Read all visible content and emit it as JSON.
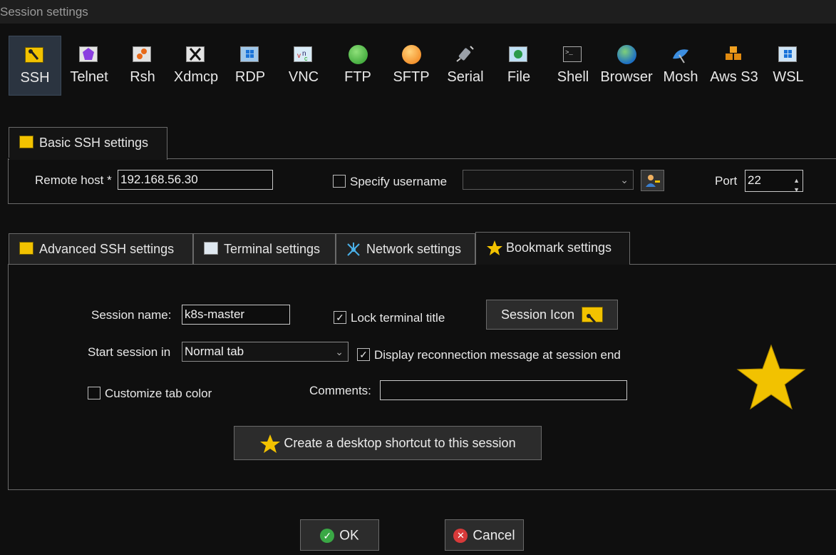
{
  "window": {
    "title": "Session settings"
  },
  "protocols": [
    {
      "label": "SSH",
      "icon": "key-icon",
      "active": true
    },
    {
      "label": "Telnet",
      "icon": "purple-gem-icon"
    },
    {
      "label": "Rsh",
      "icon": "gears-icon"
    },
    {
      "label": "Xdmcp",
      "icon": "x-logo-icon"
    },
    {
      "label": "RDP",
      "icon": "windows-monitor-icon"
    },
    {
      "label": "VNC",
      "icon": "vnc-icon"
    },
    {
      "label": "FTP",
      "icon": "green-globe-icon"
    },
    {
      "label": "SFTP",
      "icon": "orange-globe-icon"
    },
    {
      "label": "Serial",
      "icon": "satellite-plug-icon"
    },
    {
      "label": "File",
      "icon": "globe-monitor-icon"
    },
    {
      "label": "Shell",
      "icon": "terminal-icon"
    },
    {
      "label": "Browser",
      "icon": "earth-icon"
    },
    {
      "label": "Mosh",
      "icon": "satellite-dish-icon"
    },
    {
      "label": "Aws S3",
      "icon": "cubes-icon"
    },
    {
      "label": "WSL",
      "icon": "windows-logo-icon"
    }
  ],
  "basic": {
    "tab_label": "Basic SSH settings",
    "remote_host_label": "Remote host *",
    "remote_host_value": "192.168.56.30",
    "specify_username_label": "Specify username",
    "specify_username_checked": false,
    "username_value": "",
    "port_label": "Port",
    "port_value": "22"
  },
  "tabs": [
    {
      "label": "Advanced SSH settings",
      "icon": "key-icon"
    },
    {
      "label": "Terminal settings",
      "icon": "terminal-gear-icon"
    },
    {
      "label": "Network settings",
      "icon": "network-icon"
    },
    {
      "label": "Bookmark settings",
      "icon": "star-icon",
      "selected": true
    }
  ],
  "bookmark": {
    "session_name_label": "Session name:",
    "session_name_value": "k8s-master",
    "lock_title_label": "Lock terminal title",
    "lock_title_checked": true,
    "session_icon_label": "Session Icon",
    "start_in_label": "Start session in",
    "start_in_value": "Normal tab",
    "reconnect_msg_label": "Display reconnection message at session end",
    "reconnect_msg_checked": true,
    "customize_color_label": "Customize tab color",
    "customize_color_checked": false,
    "comments_label": "Comments:",
    "comments_value": "",
    "shortcut_label": "Create a desktop shortcut to this session"
  },
  "footer": {
    "ok_label": "OK",
    "cancel_label": "Cancel"
  },
  "colors": {
    "star": "#f2c200",
    "accent_active": "#2b3440",
    "ok_green": "#3aa845",
    "cancel_red": "#d83a3a"
  }
}
